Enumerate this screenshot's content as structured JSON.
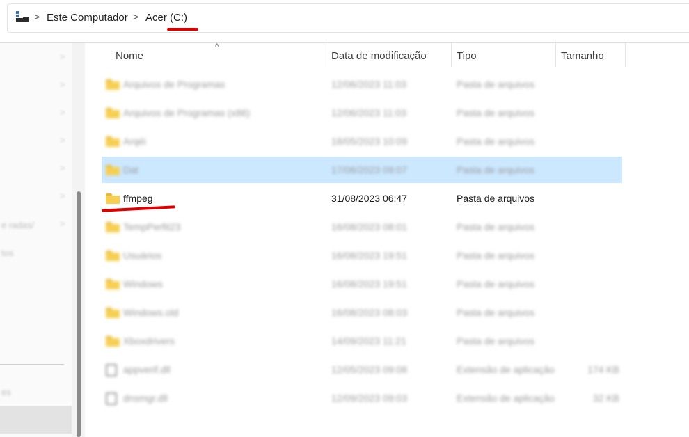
{
  "addressbar": {
    "icon": "computer-icon",
    "breadcrumb": [
      "Este Computador",
      "Acer (C:)"
    ],
    "separator": ">"
  },
  "nav": {
    "chevron": ">",
    "items": [
      {
        "label": "e radas/"
      },
      {
        "label": "tos"
      },
      {
        "label": "es"
      }
    ]
  },
  "columns": {
    "name": "Nome",
    "date": "Data de modificação",
    "type": "Tipo",
    "size": "Tamanho",
    "sort_indicator": "^"
  },
  "rows": [
    {
      "name": "Arquivos de Programas",
      "date": "12/06/2023 11:03",
      "type": "Pasta de arquivos",
      "size": "",
      "icon": "folder-icon",
      "blurred": true
    },
    {
      "name": "Arquivos de Programas (x86)",
      "date": "12/06/2023 11:03",
      "type": "Pasta de arquivos",
      "size": "",
      "icon": "folder-icon",
      "blurred": true
    },
    {
      "name": "Arqéi",
      "date": "18/05/2023 10:09",
      "type": "Pasta de arquivos",
      "size": "",
      "icon": "folder-icon",
      "blurred": true
    },
    {
      "name": "Dat",
      "date": "17/06/2023 09:07",
      "type": "Pasta de arquivos",
      "size": "",
      "icon": "folder-icon",
      "blurred": true,
      "selected": true
    },
    {
      "name": "ffmpeg",
      "date": "31/08/2023 06:47",
      "type": "Pasta de arquivos",
      "size": "",
      "icon": "folder-icon",
      "blurred": false
    },
    {
      "name": "TempPerfit23",
      "date": "16/08/2023 08:01",
      "type": "Pasta de arquivos",
      "size": "",
      "icon": "folder-icon",
      "blurred": true
    },
    {
      "name": "Usuários",
      "date": "16/08/2023 19:51",
      "type": "Pasta de arquivos",
      "size": "",
      "icon": "folder-icon",
      "blurred": true
    },
    {
      "name": "Windows",
      "date": "16/08/2023 19:51",
      "type": "Pasta de arquivos",
      "size": "",
      "icon": "folder-icon",
      "blurred": true
    },
    {
      "name": "Windows.old",
      "date": "16/08/2023 08:03",
      "type": "Pasta de arquivos",
      "size": "",
      "icon": "folder-icon",
      "blurred": true
    },
    {
      "name": "Xboxdrivers",
      "date": "14/09/2023 11:21",
      "type": "Pasta de arquivos",
      "size": "",
      "icon": "folder-icon",
      "blurred": true
    },
    {
      "name": "appverif.dll",
      "date": "12/05/2023 09:08",
      "type": "Extensão de aplicação",
      "size": "174 KB",
      "icon": "application-file-icon",
      "blurred": true
    },
    {
      "name": "dnsmgr.dll",
      "date": "12/09/2023 09:03",
      "type": "Extensão de aplicação",
      "size": "32 KB",
      "icon": "application-file-icon",
      "blurred": true
    }
  ],
  "colors": {
    "selected_row": "#cce8ff",
    "annotation_red": "#e00000",
    "folder_yellow": "#f6cf52"
  }
}
